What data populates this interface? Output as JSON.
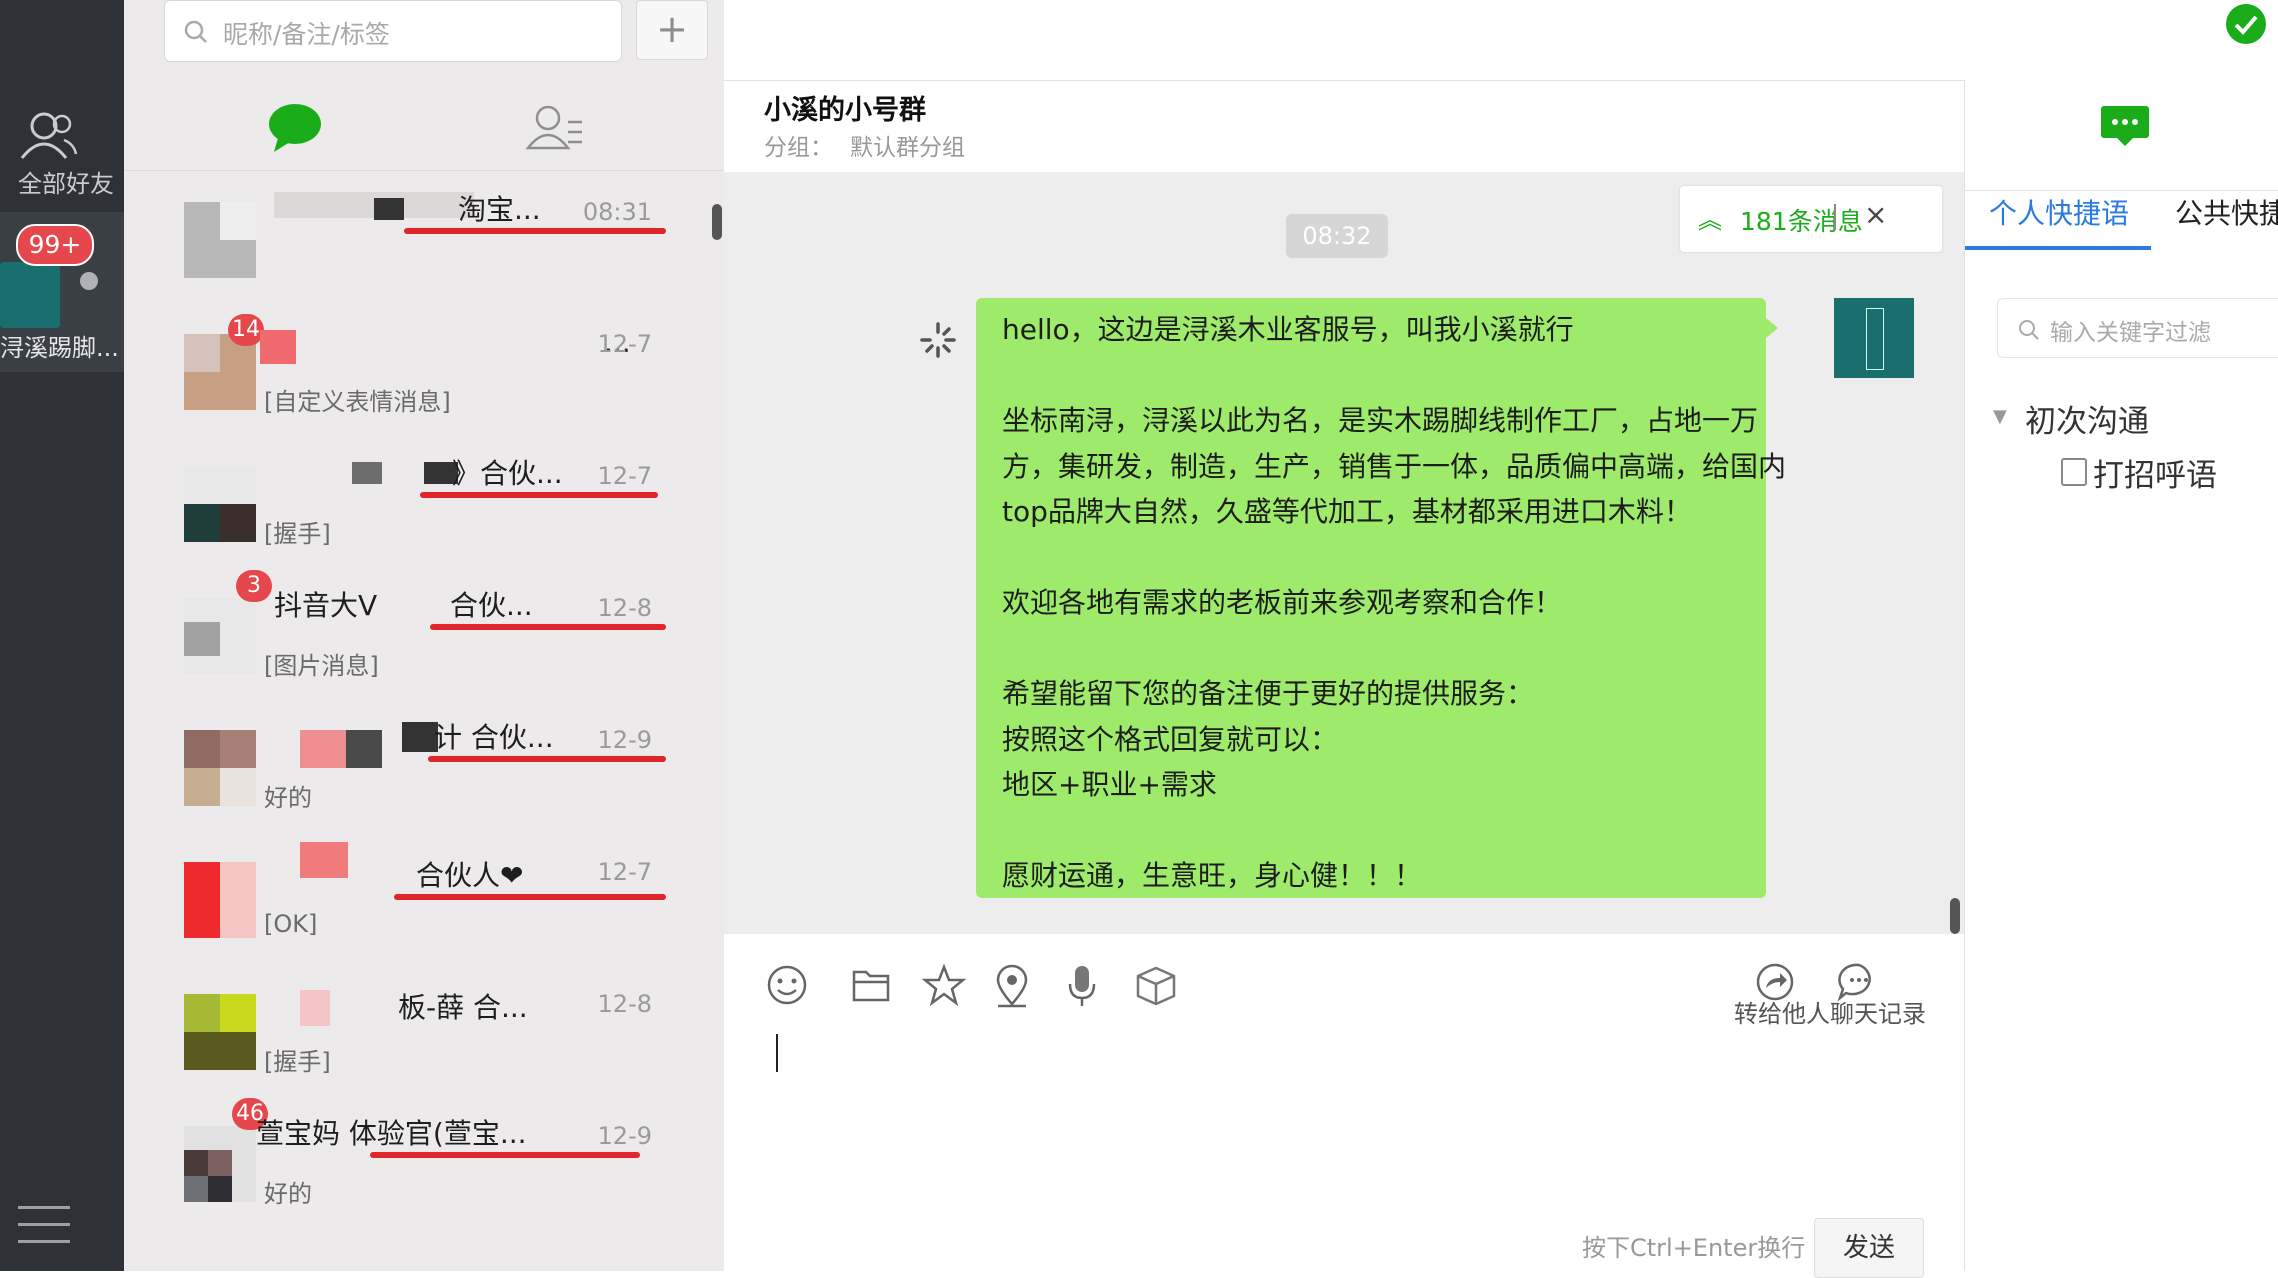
{
  "sidebar": {
    "all_friends": "全部好友",
    "selected": {
      "badge": "99+",
      "name": "浔溪踢脚..."
    }
  },
  "list": {
    "search_placeholder": "昵称/备注/标签",
    "add": "+",
    "rows": [
      {
        "title": "淘宝...",
        "time": "08:31",
        "msg": "",
        "badge": ""
      },
      {
        "title": "...",
        "time": "12-7",
        "msg": "[自定义表情消息]",
        "badge": "14"
      },
      {
        "title": "》合伙...",
        "time": "12-7",
        "msg": "[握手]",
        "badge": ""
      },
      {
        "title_prefix": "抖音大V",
        "title": "合伙...",
        "time": "12-8",
        "msg": "[图片消息]",
        "badge": "3"
      },
      {
        "title": "计 合伙...",
        "time": "12-9",
        "msg": "好的",
        "badge": ""
      },
      {
        "title": "合伙人❤",
        "time": "12-7",
        "msg": "[OK]",
        "badge": ""
      },
      {
        "title": "板-薛 合...",
        "time": "12-8",
        "msg": "[握手]",
        "badge": ""
      },
      {
        "title": "萱宝妈 体验官(萱宝...",
        "time": "12-9",
        "msg": "好的",
        "badge": "46"
      }
    ]
  },
  "chat": {
    "title": "小溪的小号群",
    "group_label": "分组：",
    "group_value": "默认群分组",
    "time_chip": "08:32",
    "unread": "181条消息",
    "message_lines": [
      "hello，这边是浔溪木业客服号，叫我小溪就行",
      "",
      "坐标南浔，浔溪以此为名，是实木踢脚线制作工厂，占地一万",
      "方，集研发，制造，生产，销售于一体，品质偏中高端，给国内",
      "top品牌大自然，久盛等代加工，基材都采用进口木料！",
      "",
      "欢迎各地有需求的老板前来参观考察和合作！",
      "",
      "希望能留下您的备注便于更好的提供服务：",
      "按照这个格式回复就可以：",
      "地区+职业+需求",
      "",
      "愿财运通，生意旺，身心健！！！"
    ],
    "toolbar": {
      "forward_label": "转给他人",
      "history_label": "聊天记录"
    },
    "hint": "按下Ctrl+Enter换行",
    "send": "发送"
  },
  "right": {
    "tab_personal": "个人快捷语",
    "tab_public": "公共快捷",
    "search_placeholder": "输入关键字过滤",
    "group": "初次沟通",
    "item": "打招呼语"
  },
  "colors": {
    "sidebar_bg": "#2e3238",
    "bubble": "#9eea6a",
    "accent_green": "#1aad19",
    "accent_blue": "#2a7ae2",
    "badge_red": "#e5474d"
  }
}
